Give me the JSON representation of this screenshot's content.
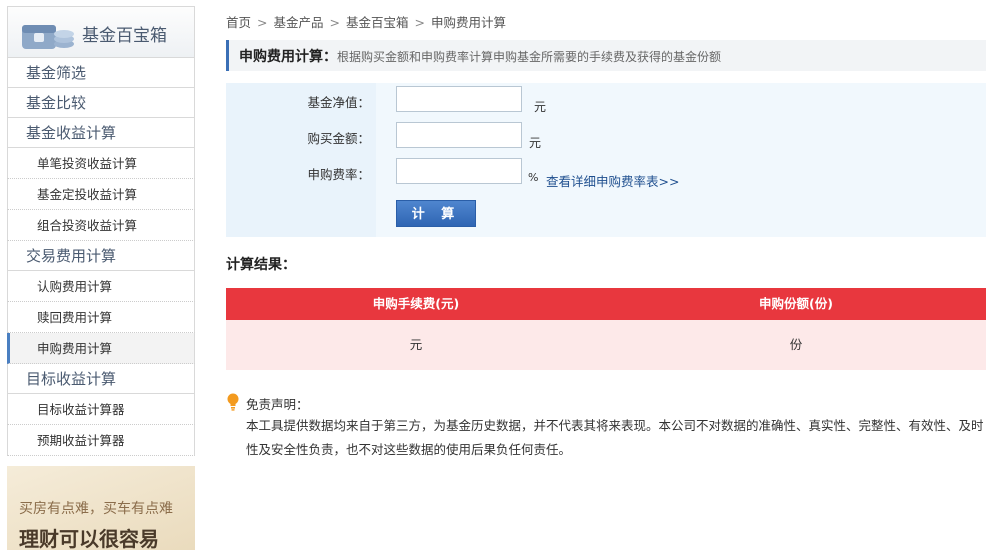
{
  "sidebar": {
    "title": "基金百宝箱",
    "menu": [
      {
        "label": "基金筛选",
        "type": "category"
      },
      {
        "label": "基金比较",
        "type": "category"
      },
      {
        "label": "基金收益计算",
        "type": "category"
      },
      {
        "label": "单笔投资收益计算",
        "type": "sub"
      },
      {
        "label": "基金定投收益计算",
        "type": "sub"
      },
      {
        "label": "组合投资收益计算",
        "type": "sub"
      },
      {
        "label": "交易费用计算",
        "type": "category"
      },
      {
        "label": "认购费用计算",
        "type": "sub"
      },
      {
        "label": "赎回费用计算",
        "type": "sub"
      },
      {
        "label": "申购费用计算",
        "type": "sub",
        "active": true
      },
      {
        "label": "目标收益计算",
        "type": "category"
      },
      {
        "label": "目标收益计算器",
        "type": "sub"
      },
      {
        "label": "预期收益计算器",
        "type": "sub"
      }
    ],
    "ad": {
      "line1": "买房有点难，买车有点难",
      "line2": "理财可以很容易"
    }
  },
  "breadcrumb": [
    "首页",
    "基金产品",
    "基金百宝箱",
    "申购费用计算"
  ],
  "calculator": {
    "title": "申购费用计算：",
    "description": "根据购买金额和申购费率计算申购基金所需要的手续费及获得的基金份额",
    "fields": [
      {
        "label": "基金净值：",
        "value": "",
        "unit": "元"
      },
      {
        "label": "购买金额：",
        "value": "",
        "unit": "元"
      },
      {
        "label": "申购费率：",
        "value": "",
        "unit": "%"
      }
    ],
    "rate_link": "查看详细申购费率表>>",
    "button": "计 算"
  },
  "result": {
    "title": "计算结果：",
    "headers": [
      "申购手续费(元)",
      "申购份额(份)"
    ],
    "values": [
      "元",
      "份"
    ]
  },
  "disclaimer": {
    "title": "免责声明：",
    "body": "本工具提供数据均来自于第三方，为基金历史数据，并不代表其将来表现。本公司不对数据的准确性、真实性、完整性、有效性、及时性及安全性负责，也不对这些数据的使用后果负任何责任。"
  },
  "colors": {
    "accent_blue": "#3a6fb6",
    "result_header": "#e8373e",
    "result_row": "#fde9e9"
  }
}
